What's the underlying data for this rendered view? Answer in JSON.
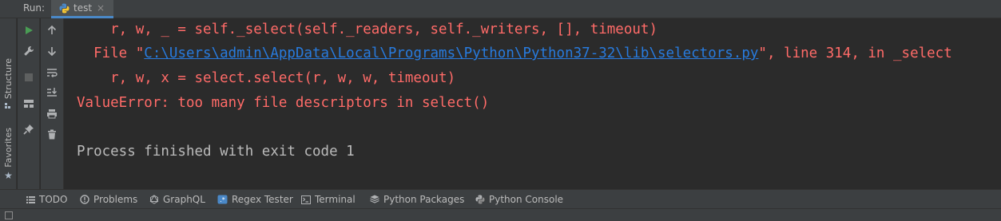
{
  "run_header": {
    "run_label": "Run:",
    "tab_label": "test",
    "close_label": "×"
  },
  "left_strip": {
    "structure_label": "Structure",
    "favorites_label": "Favorites"
  },
  "console": {
    "lines": [
      {
        "text": "    r, w, _ = self._select(self._readers, self._writers, [], timeout)"
      },
      {
        "prefix": "  File \"",
        "link": "C:\\Users\\admin\\AppData\\Local\\Programs\\Python\\Python37-32\\lib\\selectors.py",
        "suffix": "\", line 314, in _select"
      },
      {
        "text": "    r, w, x = select.select(r, w, w, timeout)"
      },
      {
        "text": "ValueError: too many file descriptors in select()"
      },
      {
        "text": "Process finished with exit code 1"
      }
    ]
  },
  "bottom_bar": {
    "items": [
      {
        "label": "TODO",
        "icon": "list-icon"
      },
      {
        "label": "Problems",
        "icon": "warning-icon"
      },
      {
        "label": "GraphQL",
        "icon": "graphql-icon"
      },
      {
        "label": "Regex Tester",
        "icon": "regex-icon"
      },
      {
        "label": "Terminal",
        "icon": "terminal-icon"
      },
      {
        "label": "Python Packages",
        "icon": "packages-icon"
      },
      {
        "label": "Python Console",
        "icon": "python-console-icon"
      }
    ]
  },
  "colors": {
    "error": "#ff6b68",
    "link": "#287bde",
    "run_green": "#499c54"
  }
}
